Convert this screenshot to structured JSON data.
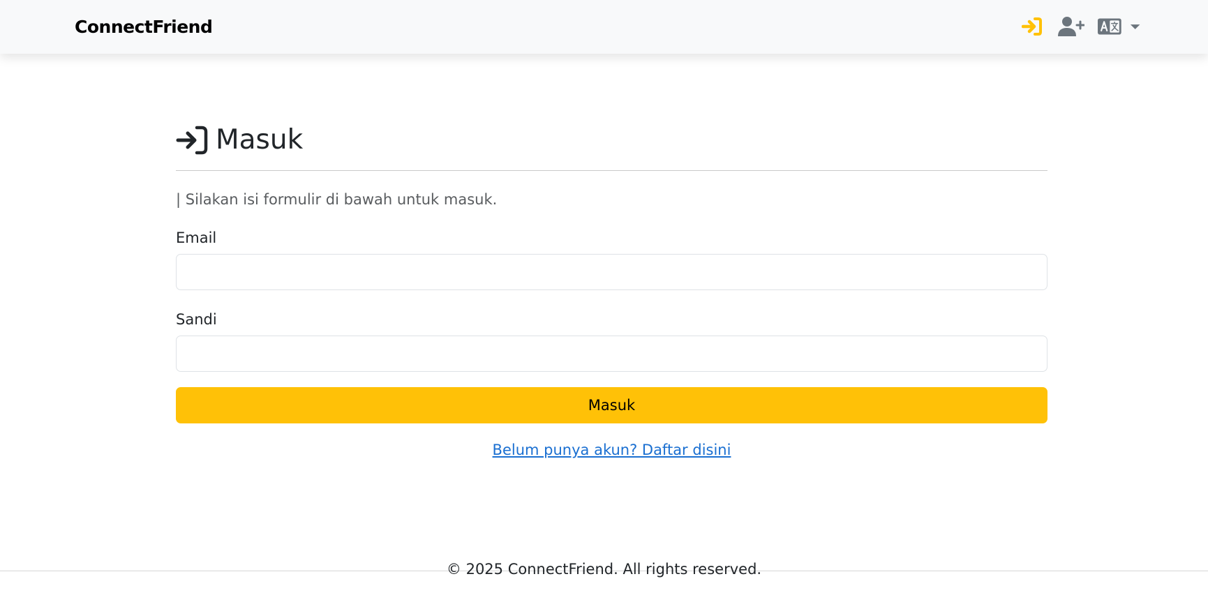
{
  "navbar": {
    "brand": "ConnectFriend",
    "icons": {
      "login": "sign-in-icon",
      "register": "user-plus-icon",
      "language": "language-icon",
      "dropdown": "caret-down-icon"
    },
    "accent_color": "#ffc107"
  },
  "page": {
    "title": "Masuk",
    "title_icon": "sign-in-icon",
    "subtitle": "| Silakan isi formulir di bawah untuk masuk."
  },
  "form": {
    "email_label": "Email",
    "email_value": "",
    "password_label": "Sandi",
    "password_value": "",
    "submit_label": "Masuk",
    "submit_color": "#ffc107"
  },
  "register_link": "Belum punya akun? Daftar disini",
  "footer": {
    "copyright": "© 2025 ConnectFriend. All rights reserved."
  }
}
